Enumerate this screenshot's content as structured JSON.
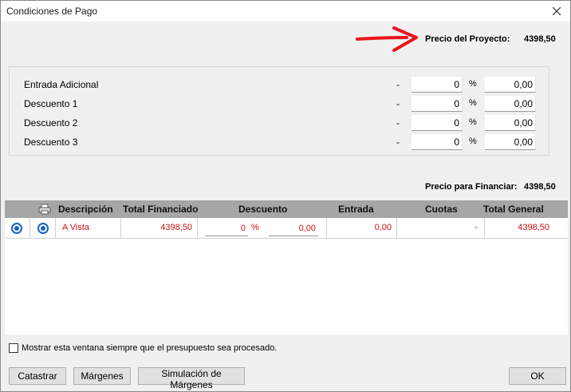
{
  "window": {
    "title": "Condiciones de Pago"
  },
  "header": {
    "project_price_label": "Precio del Proyecto:",
    "project_price_value": "4398,50"
  },
  "adjustments": [
    {
      "label": "Entrada Adicional",
      "dash": "-",
      "percent": "0",
      "percent_sign": "%",
      "amount": "0,00"
    },
    {
      "label": "Descuento 1",
      "dash": "-",
      "percent": "0",
      "percent_sign": "%",
      "amount": "0,00"
    },
    {
      "label": "Descuento 2",
      "dash": "-",
      "percent": "0",
      "percent_sign": "%",
      "amount": "0,00"
    },
    {
      "label": "Descuento 3",
      "dash": "-",
      "percent": "0",
      "percent_sign": "%",
      "amount": "0,00"
    }
  ],
  "finance": {
    "label": "Precio para Financiar:",
    "value": "4398,50"
  },
  "table": {
    "columns": [
      "Descripción",
      "Total Financiado",
      "Descuento",
      "Entrada",
      "Cuotas",
      "Total General"
    ],
    "header_icon": "printer-icon",
    "rows": [
      {
        "description": "A Vista",
        "total_financiado": "4398,50",
        "descuento_pct": "0",
        "pct_sign": "%",
        "descuento_amount": "0,00",
        "entrada": "0,00",
        "cuotas": "-",
        "total_general": "4398,50"
      }
    ]
  },
  "footer": {
    "checkbox_label": "Mostrar esta ventana siempre que el presupuesto sea procesado.",
    "checkbox_checked": false,
    "buttons": {
      "catastrar": "Catastrar",
      "margenes": "Márgenes",
      "simulacion": "Simulación de Márgenes",
      "ok": "OK"
    }
  },
  "colors": {
    "accent_red": "#d01010",
    "arrow_red": "#e8151b",
    "radio_blue": "#1565c0",
    "grid_header": "#a6a6a6"
  }
}
